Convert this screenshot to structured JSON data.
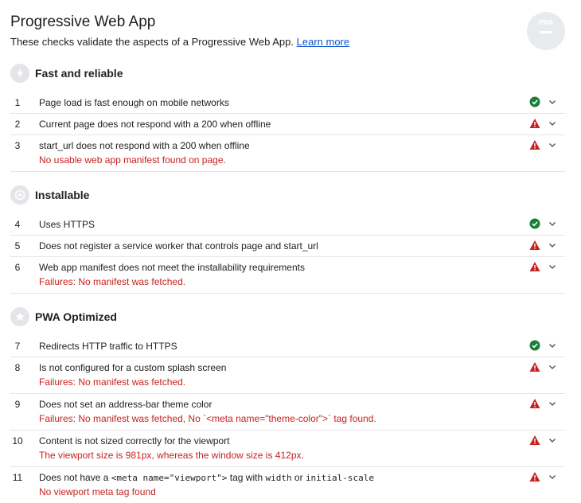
{
  "header": {
    "title": "Progressive Web App",
    "description": "These checks validate the aspects of a Progressive Web App.",
    "learn_more": "Learn more",
    "badge_label": "PWA"
  },
  "groups": [
    {
      "title": "Fast and reliable",
      "icon": "lightning-icon",
      "audits": [
        {
          "num": "1",
          "title": "Page load is fast enough on mobile networks",
          "status": "pass"
        },
        {
          "num": "2",
          "title": "Current page does not respond with a 200 when offline",
          "status": "fail"
        },
        {
          "num": "3",
          "title": "start_url does not respond with a 200 when offline",
          "status": "fail",
          "detail": "No usable web app manifest found on page."
        }
      ]
    },
    {
      "title": "Installable",
      "icon": "plus-icon",
      "audits": [
        {
          "num": "4",
          "title": "Uses HTTPS",
          "status": "pass"
        },
        {
          "num": "5",
          "title": "Does not register a service worker that controls page and start_url",
          "status": "fail"
        },
        {
          "num": "6",
          "title": "Web app manifest does not meet the installability requirements",
          "status": "fail",
          "detail": "Failures: No manifest was fetched."
        }
      ]
    },
    {
      "title": "PWA Optimized",
      "icon": "star-icon",
      "audits": [
        {
          "num": "7",
          "title": "Redirects HTTP traffic to HTTPS",
          "status": "pass"
        },
        {
          "num": "8",
          "title": "Is not configured for a custom splash screen",
          "status": "fail",
          "detail": "Failures: No manifest was fetched."
        },
        {
          "num": "9",
          "title": "Does not set an address-bar theme color",
          "status": "fail",
          "detail": "Failures: No manifest was fetched, No `<meta name=\"theme-color\">` tag found."
        },
        {
          "num": "10",
          "title": "Content is not sized correctly for the viewport",
          "status": "fail",
          "detail": "The viewport size is 981px, whereas the window size is 412px."
        },
        {
          "num": "11",
          "title_parts": [
            "Does not have a ",
            "<meta name=\"viewport\">",
            " tag with ",
            "width",
            " or ",
            "initial-scale"
          ],
          "status": "fail",
          "detail": "No viewport meta tag found"
        }
      ]
    }
  ],
  "colors": {
    "pass": "#188038",
    "fail": "#c5221f",
    "link": "#1155cc"
  }
}
